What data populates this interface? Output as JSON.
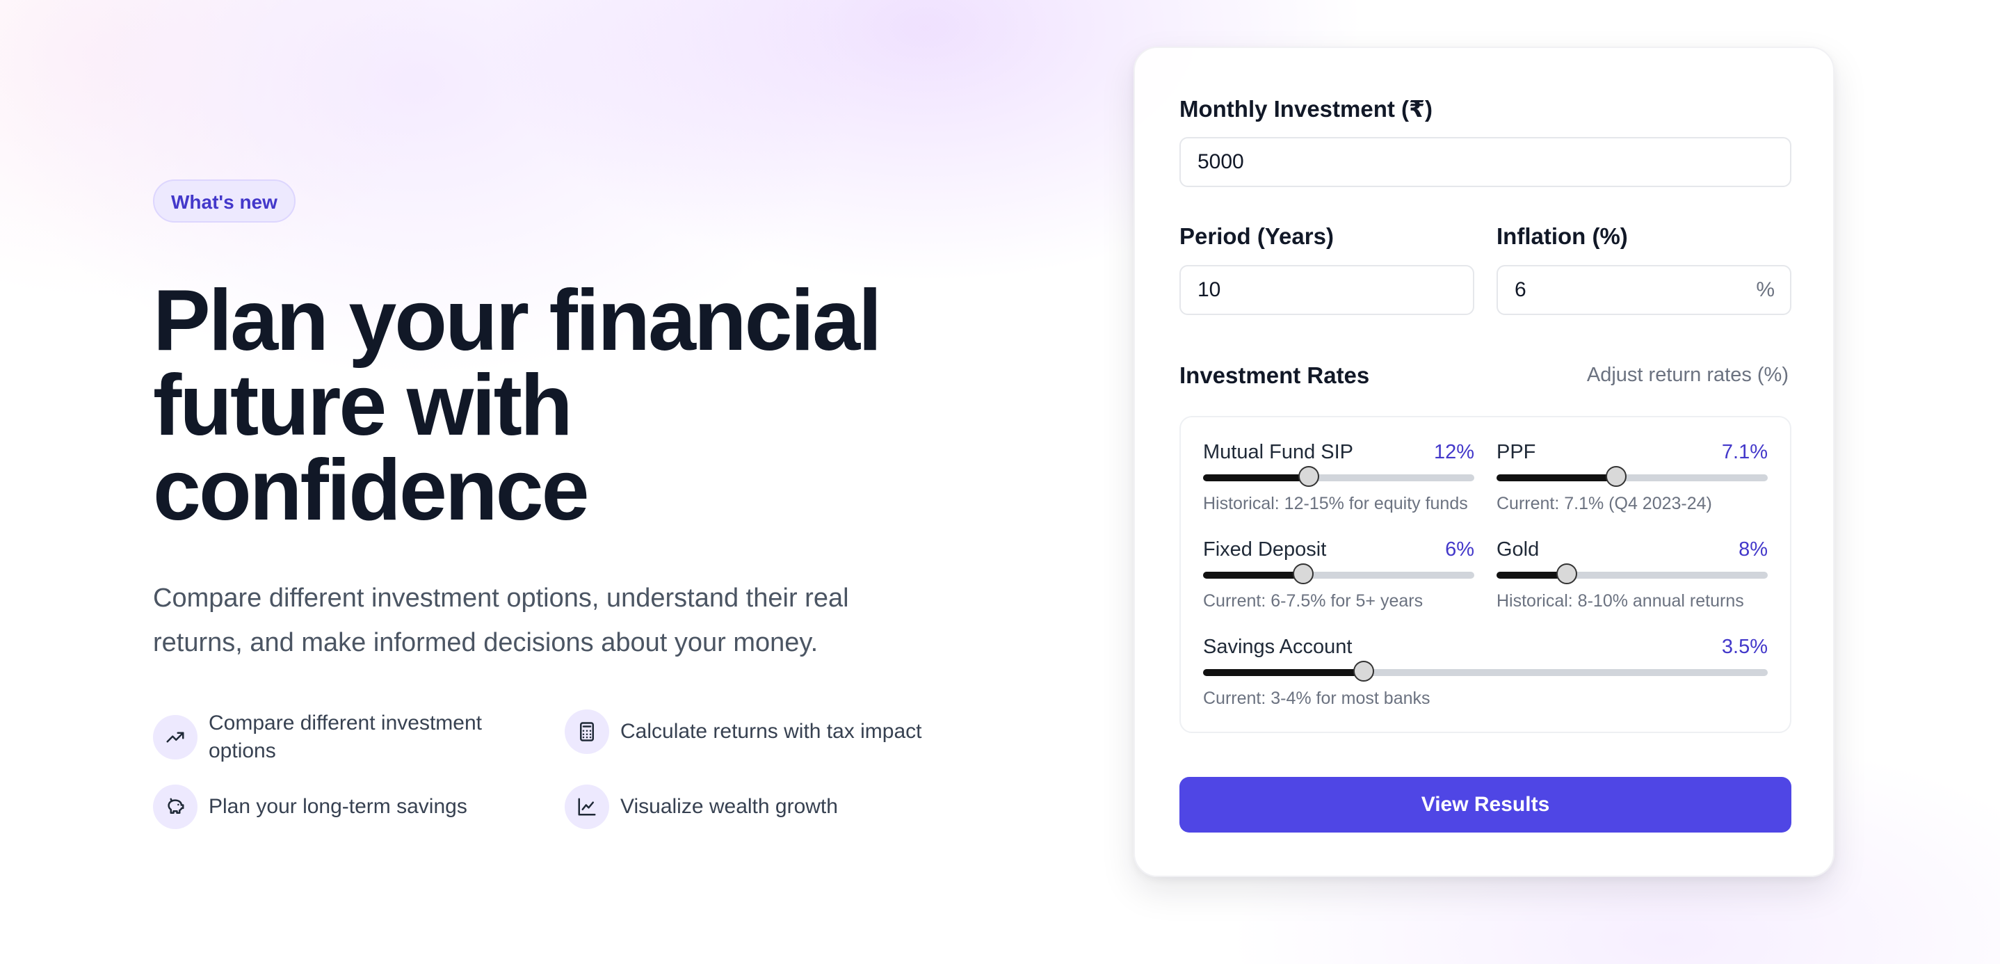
{
  "hero": {
    "badge": "What's new",
    "headline": "Plan your financial future with confidence",
    "lede": "Compare different investment options, understand their real returns, and make informed decisions about your money."
  },
  "features": [
    {
      "icon": "trending-up-icon",
      "text": "Compare different investment options"
    },
    {
      "icon": "calculator-icon",
      "text": "Calculate returns with tax impact"
    },
    {
      "icon": "piggy-bank-icon",
      "text": "Plan your long-term savings"
    },
    {
      "icon": "line-chart-icon",
      "text": "Visualize wealth growth"
    }
  ],
  "form": {
    "monthly_investment": {
      "label": "Monthly Investment (₹)",
      "value": "5000"
    },
    "period": {
      "label": "Period (Years)",
      "value": "10"
    },
    "inflation": {
      "label": "Inflation (%)",
      "value": "6",
      "suffix": "%"
    }
  },
  "rates": {
    "title": "Investment Rates",
    "subtitle": "Adjust return rates (%)",
    "items": [
      {
        "name": "Mutual Fund SIP",
        "value": "12%",
        "level": 0.39,
        "note": "Historical: 12-15% for equity funds"
      },
      {
        "name": "PPF",
        "value": "7.1%",
        "level": 0.44,
        "note": "Current: 7.1% (Q4 2023-24)"
      },
      {
        "name": "Fixed Deposit",
        "value": "6%",
        "level": 0.37,
        "note": "Current: 6-7.5% for 5+ years"
      },
      {
        "name": "Gold",
        "value": "8%",
        "level": 0.26,
        "note": "Historical: 8-10% annual returns"
      },
      {
        "name": "Savings Account",
        "value": "3.5%",
        "level": 0.285,
        "note": "Current: 3-4% for most banks"
      }
    ]
  },
  "cta": {
    "label": "View Results"
  },
  "colors": {
    "accent": "#4f46e5",
    "accent_text": "#4338ca",
    "badge_bg": "#ede9fe",
    "headline": "#111827"
  }
}
